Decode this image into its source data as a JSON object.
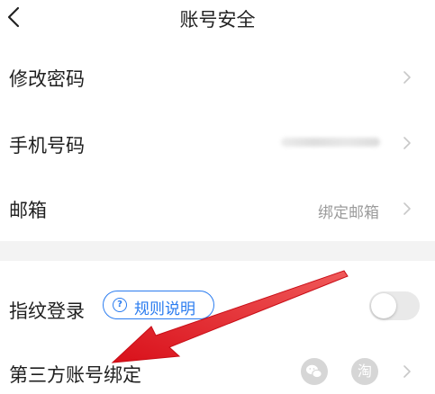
{
  "header": {
    "title": "账号安全",
    "back_icon": "chevron-left-icon"
  },
  "rows": [
    {
      "label": "修改密码",
      "value": ""
    },
    {
      "label": "手机号码",
      "value": ""
    },
    {
      "label": "邮箱",
      "value": "绑定邮箱"
    }
  ],
  "fingerprint": {
    "label": "指纹登录",
    "rule_link": "规则说明",
    "toggle_on": false
  },
  "third_party": {
    "label": "第三方账号绑定",
    "icons": [
      "wechat-icon",
      "taobao-icon"
    ],
    "taobao_glyph": "淘"
  },
  "colors": {
    "accent": "#2a7cf0",
    "arrow": "#e0161b",
    "separator": "#f3f3f3",
    "muted_text": "#9b9b9b"
  }
}
